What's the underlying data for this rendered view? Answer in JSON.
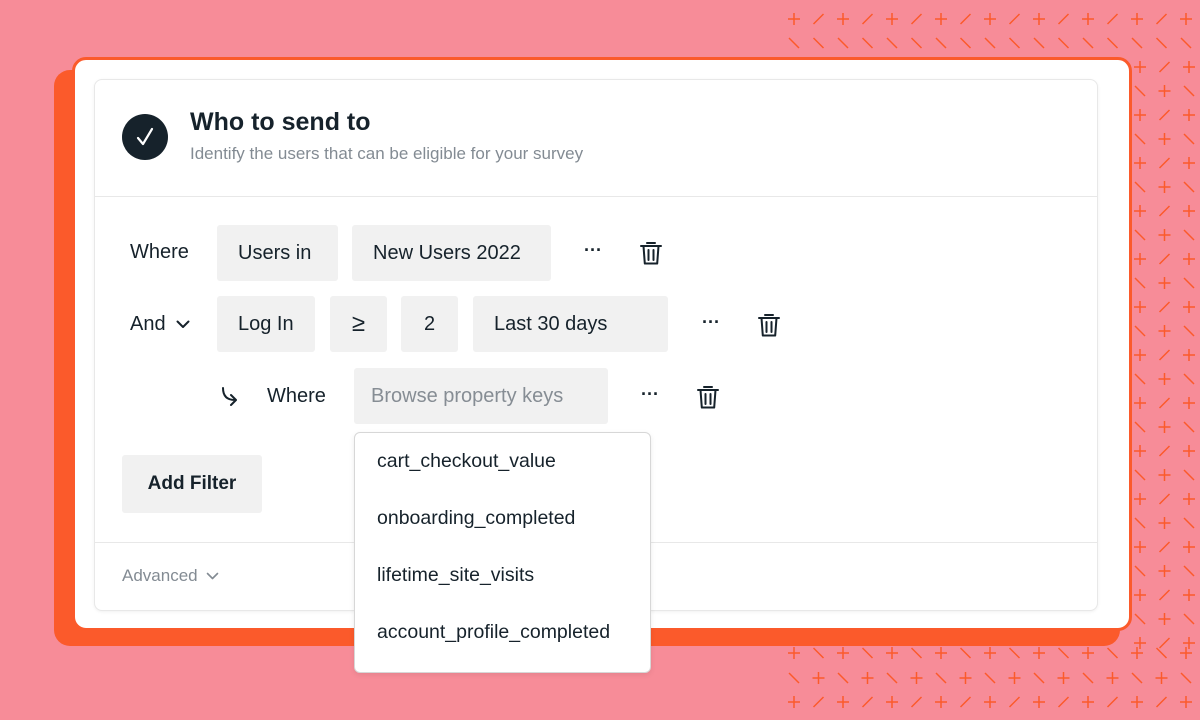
{
  "section": {
    "title": "Who to send to",
    "subtitle": "Identify the users that can be eligible for your survey"
  },
  "filters": {
    "row1": {
      "connector": "Where",
      "field": "Users in",
      "value": "New Users 2022",
      "more": "···"
    },
    "row2": {
      "connector": "And",
      "field": "Log In",
      "operator": "≥",
      "count": "2",
      "period": "Last 30 days",
      "more": "···"
    },
    "row3": {
      "connector": "Where",
      "placeholder": "Browse property keys",
      "more": "···"
    }
  },
  "add_filter_label": "Add Filter",
  "advanced_label": "Advanced",
  "property_keys": [
    "cart_checkout_value",
    "onboarding_completed",
    "lifetime_site_visits",
    "account_profile_completed"
  ],
  "colors": {
    "background": "#f78c98",
    "accent": "#fb5a2b",
    "text": "#16222b",
    "chip": "#f1f1f1"
  }
}
